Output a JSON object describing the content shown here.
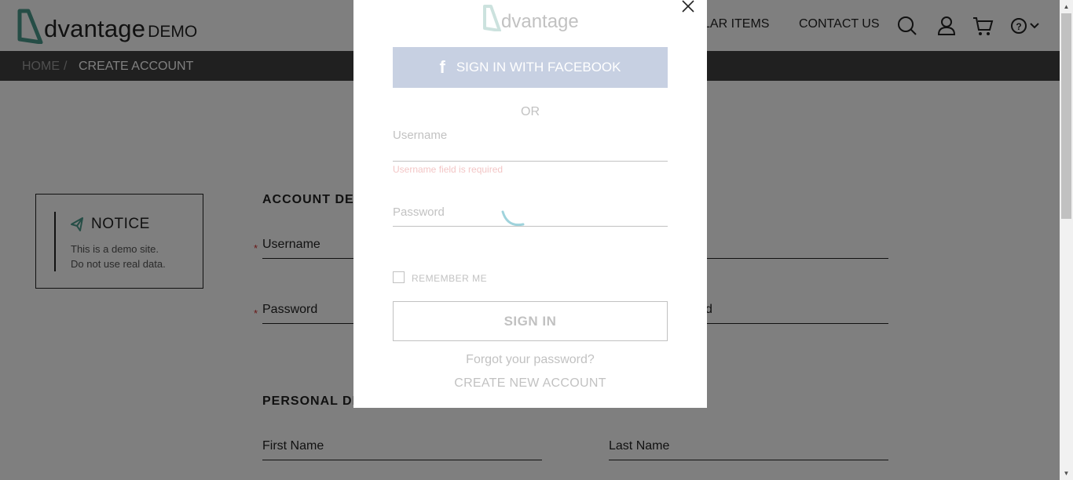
{
  "header": {
    "logo_word": "dvantage",
    "logo_suffix": "DEMO",
    "nav_items": [
      "LAR ITEMS",
      "CONTACT US"
    ],
    "icons": [
      "search-icon",
      "user-icon",
      "cart-icon",
      "help-icon",
      "chevron-down-icon"
    ]
  },
  "breadcrumb": {
    "home": "HOME",
    "separator": "/",
    "current": "CREATE ACCOUNT"
  },
  "notice": {
    "title": "NOTICE",
    "line1": "This is a demo site.",
    "line2": "Do not use real data."
  },
  "form": {
    "account_section": "ACCOUNT DET",
    "username_label": "Username",
    "password_label": "Password",
    "confirm_password_fragment": "d",
    "required_mark": "*",
    "personal_section": "PERSONAL DE",
    "first_name_label": "First Name",
    "last_name_label": "Last Name"
  },
  "modal": {
    "logo_text": "dvantage",
    "facebook_label": "SIGN IN WITH FACEBOOK",
    "or_text": "OR",
    "username_label": "Username",
    "username_error": "Username field is required",
    "password_label": "Password",
    "remember_label": "REMEMBER ME",
    "signin_label": "SIGN IN",
    "forgot_link": "Forgot your password?",
    "create_link": "CREATE NEW ACCOUNT"
  },
  "colors": {
    "brand_teal": "#5fb9a8",
    "facebook_blue": "#3b5998",
    "error_red": "#d3302f",
    "breadcrumb_bg": "#414141"
  }
}
